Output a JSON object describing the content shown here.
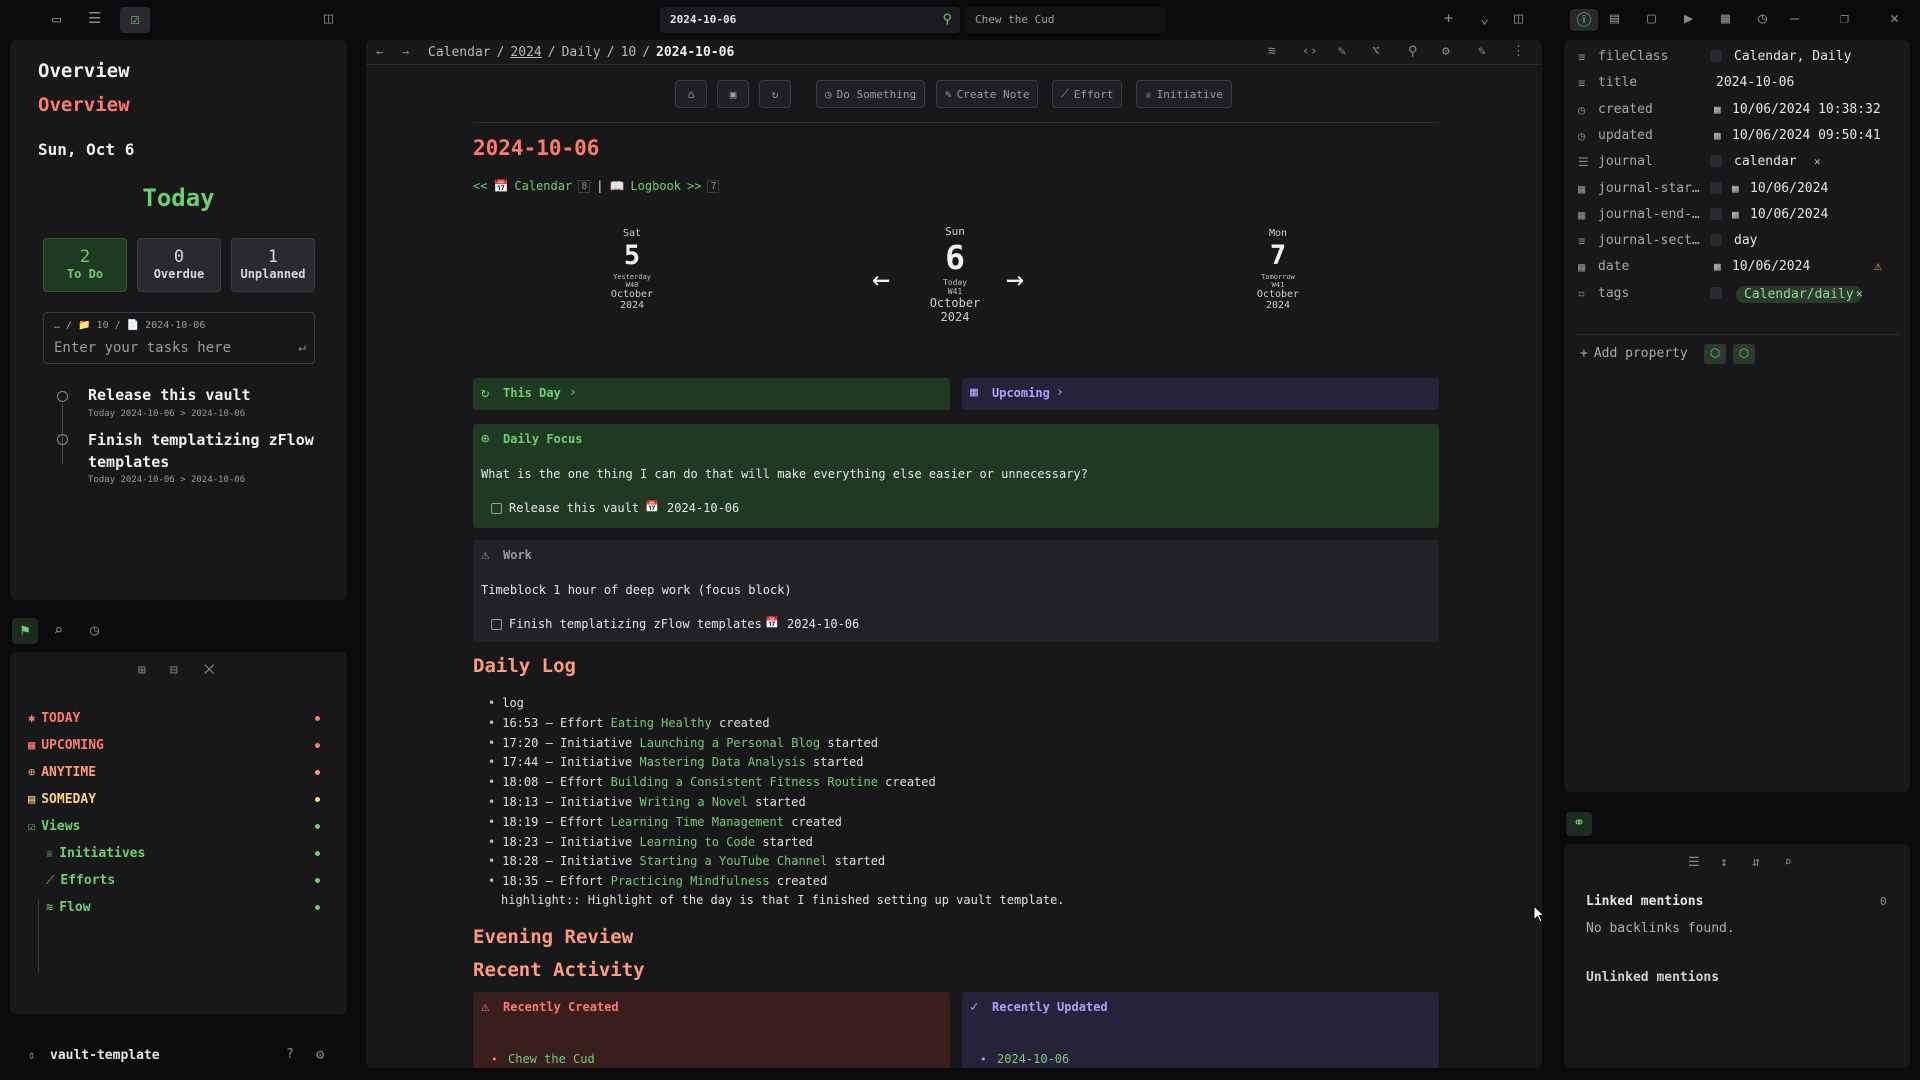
{
  "topbar": {
    "tab_active": "2024-10-06",
    "tab_other": "Chew the Cud"
  },
  "breadcrumb": {
    "items": [
      "Calendar",
      "/",
      "2024",
      "/",
      "Daily",
      "/",
      "10",
      "/",
      "2024-10-06"
    ]
  },
  "left": {
    "overview_title": "Overview",
    "overview_subtitle": "Overview",
    "date": "Sun, Oct 6",
    "today": "Today",
    "stats": [
      {
        "value": "2",
        "label": "To Do"
      },
      {
        "value": "0",
        "label": "Overdue"
      },
      {
        "value": "1",
        "label": "Unplanned"
      }
    ],
    "task_input": {
      "path": "… / 📁 10 / 📄 2024-10-06",
      "placeholder": "Enter your tasks here"
    },
    "tasks": [
      {
        "title": "Release this vault",
        "meta": "Today  2024-10-06 > 2024-10-06"
      },
      {
        "title": "Finish templatizing zFlow templates",
        "meta": "Today  2024-10-06 > 2024-10-06"
      }
    ],
    "bookmarks": [
      {
        "label": "TODAY",
        "color": "#ff7a6a"
      },
      {
        "label": "UPCOMING",
        "color": "#ff7a6a"
      },
      {
        "label": "ANYTIME",
        "color": "#ff9a7a"
      },
      {
        "label": "SOMEDAY",
        "color": "#ffd27a"
      },
      {
        "label": "Views",
        "color": "#6fcf6f"
      },
      {
        "label": "Initiatives",
        "color": "#6fcf6f"
      },
      {
        "label": "Efforts",
        "color": "#6fcf6f"
      },
      {
        "label": "Flow",
        "color": "#6fcf6f"
      }
    ],
    "vault_name": "vault-template"
  },
  "toolbar": {
    "do_something": "Do Something",
    "create_note": "Create Note",
    "effort": "Effort",
    "initiative": "Initiative"
  },
  "note": {
    "title": "2024-10-06",
    "nav": {
      "prev": "<<",
      "calendar": "Calendar",
      "calendar_count": "8",
      "sep": "|",
      "logbook": "Logbook",
      "next": ">>",
      "logbook_count": "7"
    },
    "days": [
      {
        "dow": "Sat",
        "num": "5",
        "rel": "Yesterday",
        "week": "W40",
        "month": "October",
        "year": "2024"
      },
      {
        "dow": "Sun",
        "num": "6",
        "rel": "Today",
        "week": "W41",
        "month": "October",
        "year": "2024"
      },
      {
        "dow": "Mon",
        "num": "7",
        "rel": "Tomorrow",
        "week": "W41",
        "month": "October",
        "year": "2024"
      }
    ],
    "this_day": "This Day",
    "upcoming": "Upcoming",
    "daily_focus": {
      "heading": "Daily Focus",
      "question": "What is the one thing I can do that will make everything else easier or unnecessary?",
      "task": "Release this vault",
      "date": "2024-10-06"
    },
    "work": {
      "heading": "Work",
      "text": "Timeblock 1 hour of deep work (focus block)",
      "task": "Finish templatizing zFlow templates",
      "date": "2024-10-06"
    },
    "daily_log_heading": "Daily Log",
    "log": [
      {
        "pre": "log",
        "link": "",
        "post": ""
      },
      {
        "pre": "16:53 – Effort ",
        "link": "Eating Healthy",
        "post": " created"
      },
      {
        "pre": "17:20 – Initiative ",
        "link": "Launching a Personal Blog",
        "post": " started"
      },
      {
        "pre": "17:44 – Initiative ",
        "link": "Mastering Data Analysis",
        "post": " started"
      },
      {
        "pre": "18:08 – Effort ",
        "link": "Building a Consistent Fitness Routine",
        "post": " created"
      },
      {
        "pre": "18:13 – Initiative ",
        "link": "Writing a Novel",
        "post": " started"
      },
      {
        "pre": "18:19 – Effort ",
        "link": "Learning Time Management",
        "post": " created"
      },
      {
        "pre": "18:23 – Initiative ",
        "link": "Learning to Code",
        "post": " started"
      },
      {
        "pre": "18:28 – Initiative ",
        "link": "Starting a YouTube Channel",
        "post": " started"
      },
      {
        "pre": "18:35 – Effort ",
        "link": "Practicing Mindfulness",
        "post": " created"
      }
    ],
    "highlight": "highlight:: Highlight of the day is that I finished setting up vault template.",
    "evening_review": "Evening Review",
    "recent_activity": "Recent Activity",
    "recently_created": "Recently Created",
    "recently_created_item": "Chew the Cud",
    "recently_updated": "Recently Updated",
    "recently_updated_item": "2024-10-06"
  },
  "properties": [
    {
      "name": "fileClass",
      "value": "Calendar, Daily"
    },
    {
      "name": "title",
      "value": "2024-10-06"
    },
    {
      "name": "created",
      "value": "10/06/2024 10:38:32"
    },
    {
      "name": "updated",
      "value": "10/06/2024 09:50:41"
    },
    {
      "name": "journal",
      "value": "calendar"
    },
    {
      "name": "journal-star…",
      "value": "10/06/2024"
    },
    {
      "name": "journal-end-…",
      "value": "10/06/2024"
    },
    {
      "name": "journal-sect…",
      "value": "day"
    },
    {
      "name": "date",
      "value": "10/06/2024"
    },
    {
      "name": "tags",
      "value": "Calendar/daily"
    }
  ],
  "add_property": "Add property",
  "backlinks": {
    "linked": "Linked mentions",
    "linked_count": "0",
    "none": "No backlinks found.",
    "unlinked": "Unlinked mentions"
  }
}
